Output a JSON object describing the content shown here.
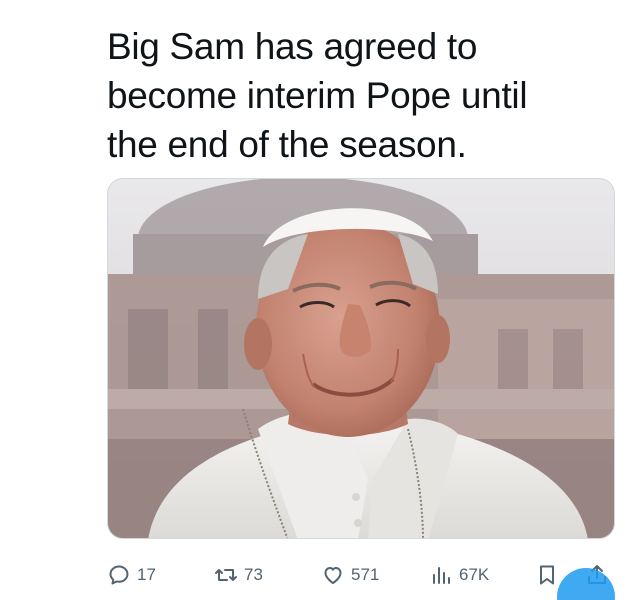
{
  "tweet": {
    "text_lines": [
      "Big Sam has agreed to",
      "become interim Pope until",
      "the end of the season."
    ]
  },
  "media": {
    "description_icon": "photo"
  },
  "actions": {
    "reply": {
      "icon": "reply-icon",
      "count": "17"
    },
    "retweet": {
      "icon": "retweet-icon",
      "count": "73"
    },
    "like": {
      "icon": "heart-icon",
      "count": "571"
    },
    "views": {
      "icon": "views-icon",
      "count": "67K"
    },
    "bookmark": {
      "icon": "bookmark-icon"
    },
    "share": {
      "icon": "share-icon"
    }
  },
  "colors": {
    "text": "#0f1419",
    "muted": "#536471",
    "accent": "#1d9bf0",
    "border": "#cfd9de"
  }
}
